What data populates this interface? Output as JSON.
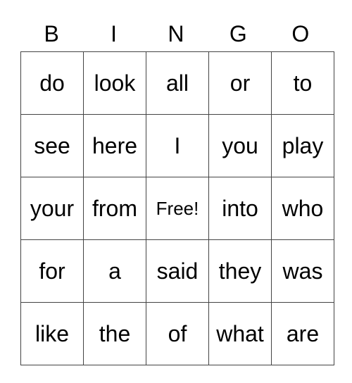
{
  "header": [
    "B",
    "I",
    "N",
    "G",
    "O"
  ],
  "rows": [
    [
      "do",
      "look",
      "all",
      "or",
      "to"
    ],
    [
      "see",
      "here",
      "I",
      "you",
      "play"
    ],
    [
      "your",
      "from",
      "Free!",
      "into",
      "who"
    ],
    [
      "for",
      "a",
      "said",
      "they",
      "was"
    ],
    [
      "like",
      "the",
      "of",
      "what",
      "are"
    ]
  ]
}
